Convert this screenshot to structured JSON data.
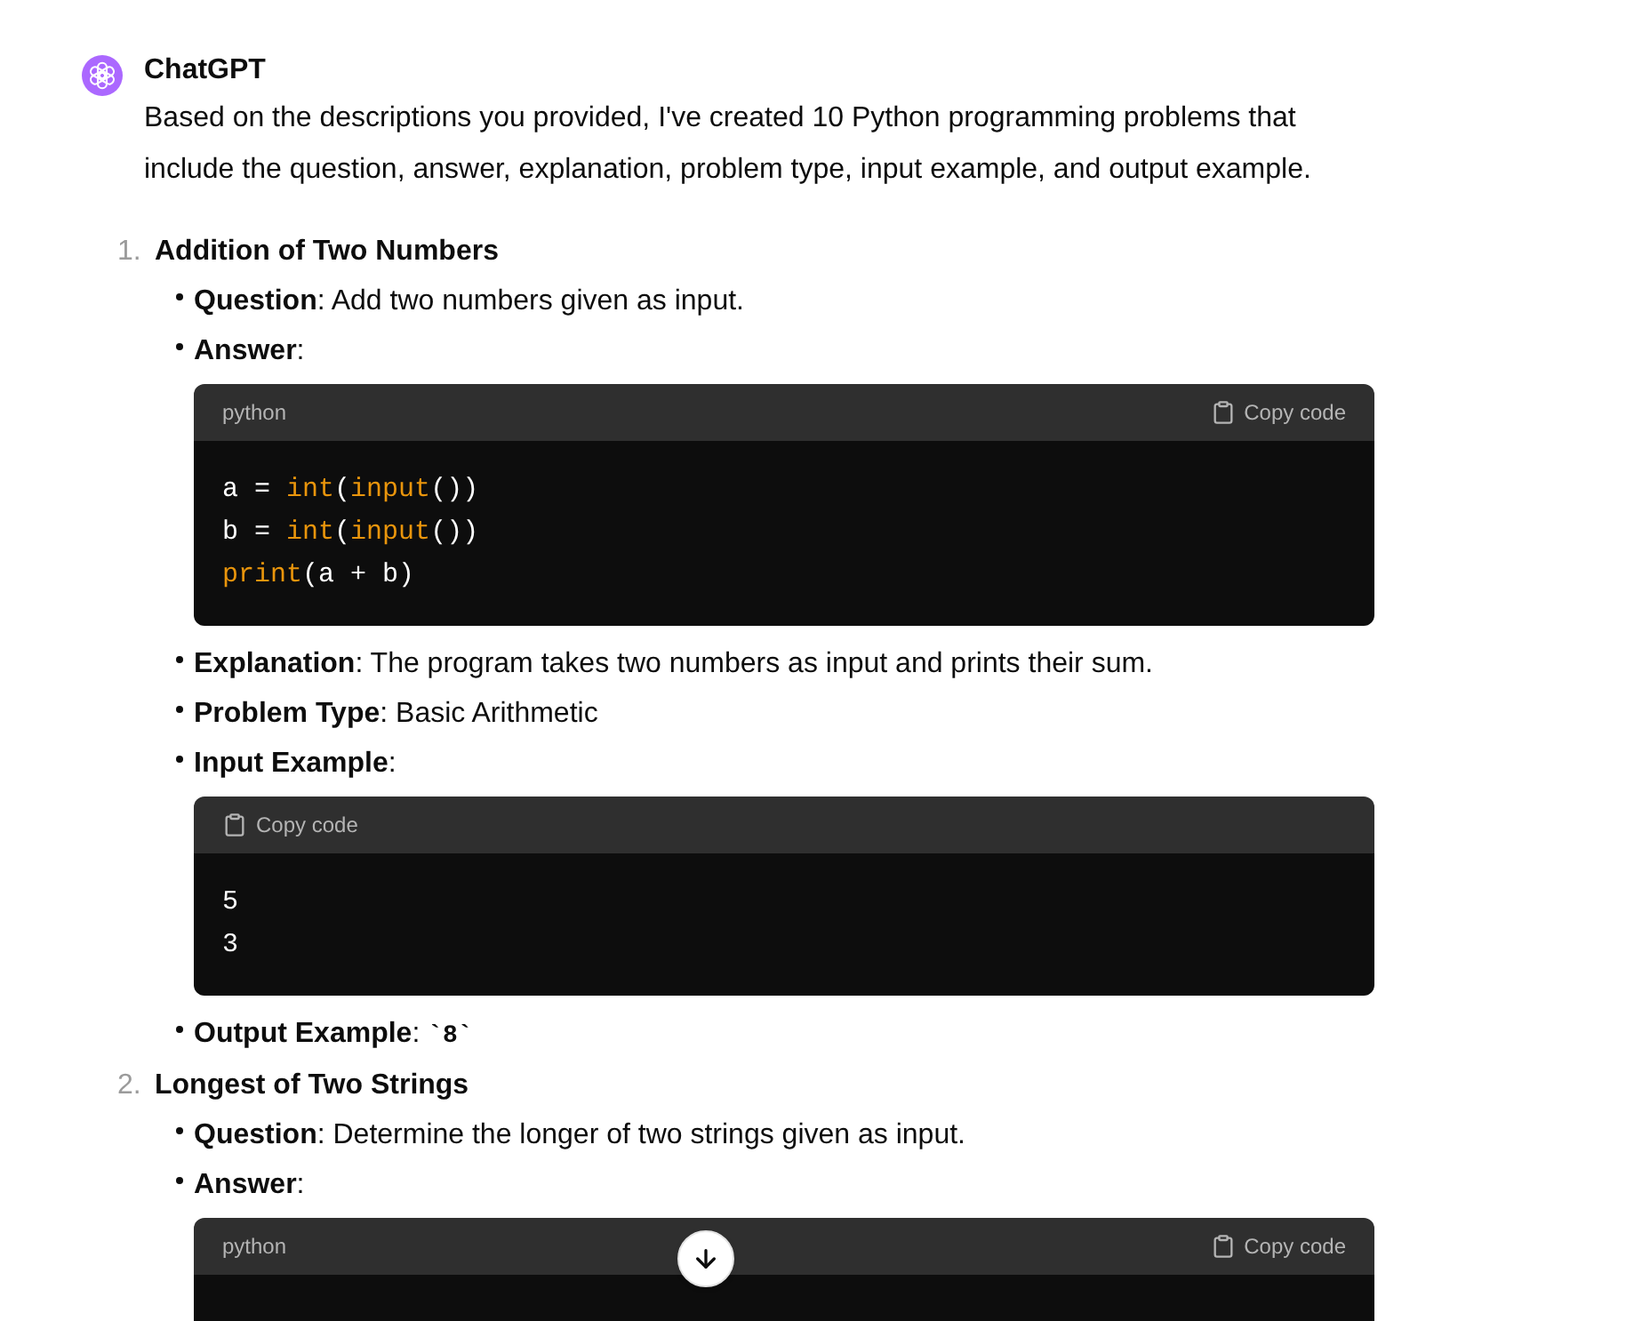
{
  "message": {
    "author": "ChatGPT",
    "intro": "Based on the descriptions you provided, I've created 10 Python programming problems that include the question, answer, explanation, problem type, input example, and output example."
  },
  "problems": [
    {
      "number": "1.",
      "title": "Addition of Two Numbers",
      "items": [
        {
          "text": "**Question**: Add two numbers given as input."
        },
        {
          "text": "**Answer**:",
          "code_block": {
            "language": "python",
            "copy_label": "Copy code",
            "lines": [
              {
                "tokens": [
                  {
                    "text": "a = ",
                    "kind": "plain"
                  },
                  {
                    "text": "int",
                    "kind": "built_in"
                  },
                  {
                    "text": "(",
                    "kind": "plain"
                  },
                  {
                    "text": "input",
                    "kind": "built_in"
                  },
                  {
                    "text": "())",
                    "kind": "plain"
                  }
                ]
              },
              {
                "tokens": [
                  {
                    "text": "b = ",
                    "kind": "plain"
                  },
                  {
                    "text": "int",
                    "kind": "built_in"
                  },
                  {
                    "text": "(",
                    "kind": "plain"
                  },
                  {
                    "text": "input",
                    "kind": "built_in"
                  },
                  {
                    "text": "())",
                    "kind": "plain"
                  }
                ]
              },
              {
                "tokens": [
                  {
                    "text": "print",
                    "kind": "built_in"
                  },
                  {
                    "text": "(a + b)",
                    "kind": "plain"
                  }
                ]
              }
            ]
          }
        },
        {
          "text": "**Explanation**: The program takes two numbers as input and prints their sum."
        },
        {
          "text": "**Problem Type**: Basic Arithmetic"
        },
        {
          "text": "**Input Example**:",
          "code_block": {
            "copy_label": "Copy code",
            "lines": [
              {
                "tokens": [
                  {
                    "text": "5",
                    "kind": "plain"
                  }
                ]
              },
              {
                "tokens": [
                  {
                    "text": "3",
                    "kind": "plain"
                  }
                ]
              }
            ]
          }
        },
        {
          "text": "**Output Example**:",
          "inline_code": "`8`"
        }
      ]
    },
    {
      "number": "2.",
      "title": "Longest of Two Strings",
      "items": [
        {
          "text": "**Question**: Determine the longer of two strings given as input."
        },
        {
          "text": "**Answer**:",
          "code_block": {
            "language": "python",
            "copy_label": "Copy code"
          }
        }
      ]
    }
  ]
}
